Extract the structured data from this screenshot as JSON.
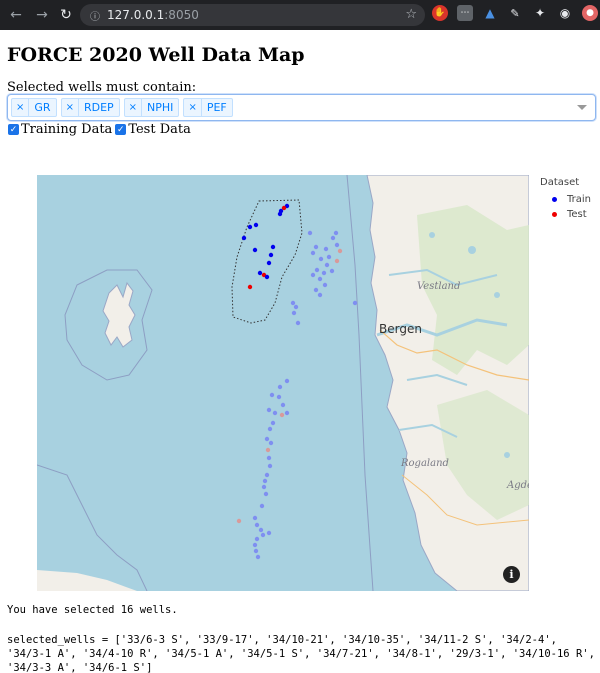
{
  "browser": {
    "url_host": "127.0.0.1",
    "url_port": ":8050",
    "back_icon": "arrow-left-icon",
    "forward_icon": "arrow-right-icon",
    "reload_icon": "reload-icon",
    "site_info_icon": "info-circle-icon",
    "bookmark_icon": "star-icon"
  },
  "page": {
    "title": "FORCE 2020 Well Data Map",
    "dropdown_label": "Selected wells must contain:",
    "selected_curves": [
      "GR",
      "RDEP",
      "NPHI",
      "PEF"
    ],
    "chip_remove_glyph": "×",
    "checkboxes": [
      {
        "label": "Training Data",
        "checked": true
      },
      {
        "label": "Test Data",
        "checked": true
      }
    ]
  },
  "map": {
    "labels": {
      "region": "Vestland",
      "city1": "Bergen",
      "city2": "Rogaland",
      "city3": "Agde"
    },
    "legend": {
      "title": "Dataset",
      "items": [
        {
          "name": "Train",
          "color": "#0000ee"
        },
        {
          "name": "Test",
          "color": "#ee0000"
        }
      ]
    },
    "info_glyph": "i"
  },
  "output": {
    "summary": "You have selected 16 wells.",
    "selected_wells_text": "selected_wells = ['33/6-3 S', '33/9-17', '34/10-21', '34/10-35', '34/11-2 S', '34/2-4', '34/3-1 A', '34/4-10 R', '34/5-1 A', '34/5-1 S', '34/7-21', '34/8-1', '29/3-1', '34/10-16 R', '34/3-3 A', '34/6-1 S']"
  },
  "colors": {
    "sea": "#a8d1e0",
    "land": "#f2efe9",
    "selected_train": "#0000ee",
    "selected_test": "#ee0000",
    "faded_train": "#7f8ff0",
    "faded_test": "#d89a9a"
  }
}
